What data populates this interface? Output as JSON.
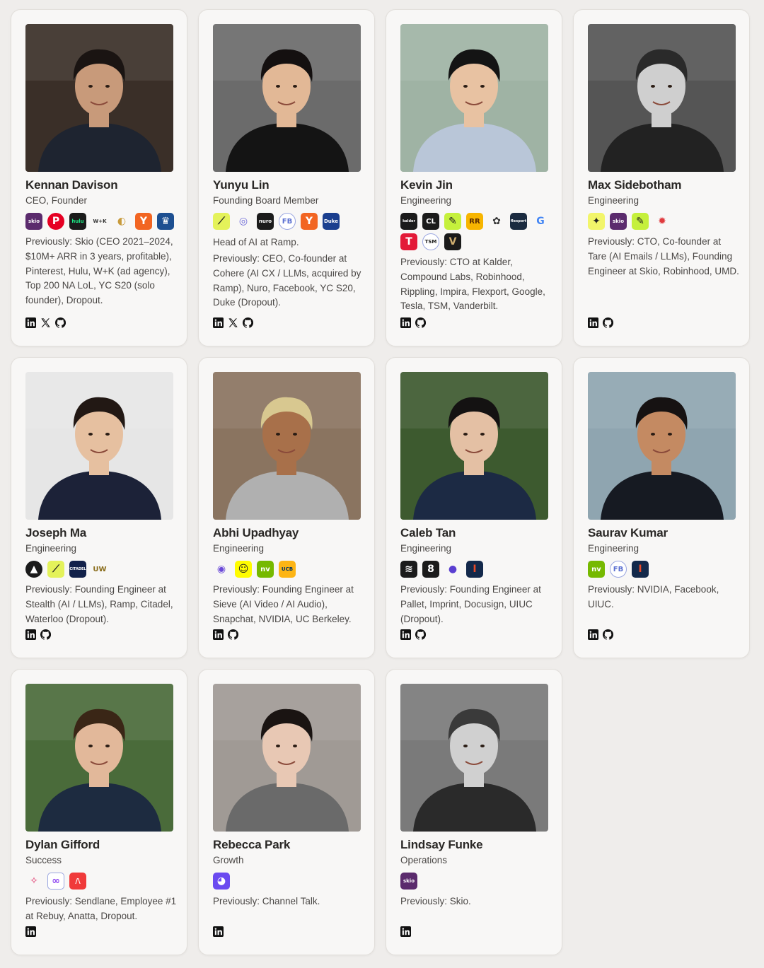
{
  "members": [
    {
      "name": "Kennan Davison",
      "role": "CEO, Founder",
      "logos": [
        {
          "icon": "skio-logo",
          "text": "skio",
          "bg": "#5b2b6d",
          "fg": "#ffffff"
        },
        {
          "icon": "pinterest-logo",
          "text": "P",
          "bg": "#e60023",
          "fg": "#ffffff",
          "shape": "round"
        },
        {
          "icon": "hulu-logo",
          "text": "hulu",
          "bg": "#1b1b1b",
          "fg": "#1ce783"
        },
        {
          "icon": "wk-logo",
          "text": "W+K",
          "bg": "transparent",
          "fg": "#333333"
        },
        {
          "icon": "lol-logo",
          "text": "◐",
          "bg": "transparent",
          "fg": "#c89b3c"
        },
        {
          "icon": "yc-logo",
          "text": "Y",
          "bg": "#f26522",
          "fg": "#ffffff"
        },
        {
          "icon": "columbia-logo",
          "text": "♛",
          "bg": "#1d4f91",
          "fg": "#ffffff"
        }
      ],
      "bio": "Previously: Skio (CEO 2021–2024, $10M+ ARR in 3 years, profitable), Pinterest, Hulu, W+K (ad agency), Top 200 NA LoL, YC S20 (solo founder), Dropout.",
      "socials": [
        "linkedin-icon",
        "x-icon",
        "github-icon"
      ]
    },
    {
      "name": "Yunyu Lin",
      "role": "Founding Board Member",
      "logos": [
        {
          "icon": "ramp-logo",
          "text": "⟋",
          "bg": "#e4f25a",
          "fg": "#222222"
        },
        {
          "icon": "cohere-logo",
          "text": "◎",
          "bg": "transparent",
          "fg": "#6e6bd8"
        },
        {
          "icon": "nuro-logo",
          "text": "nuro",
          "bg": "#1b1b1b",
          "fg": "#ffffff"
        },
        {
          "icon": "facebook-logo",
          "text": "FB",
          "bg": "#ffffff",
          "fg": "#5a6fd1",
          "shape": "round"
        },
        {
          "icon": "yc-logo",
          "text": "Y",
          "bg": "#f26522",
          "fg": "#ffffff"
        },
        {
          "icon": "duke-logo",
          "text": "Duke",
          "bg": "#1b3f8f",
          "fg": "#ffffff"
        }
      ],
      "headline": "Head of AI at Ramp.",
      "bio": "Previously: CEO, Co-founder at Cohere (AI CX / LLMs, acquired by Ramp), Nuro, Facebook, YC S20, Duke (Dropout).",
      "socials": [
        "linkedin-icon",
        "x-icon",
        "github-icon"
      ]
    },
    {
      "name": "Kevin Jin",
      "role": "Engineering",
      "logos": [
        {
          "icon": "kalder-logo",
          "text": "kalder",
          "bg": "#1b1b1b",
          "fg": "#ffffff"
        },
        {
          "icon": "compound-logo",
          "text": "CL",
          "bg": "#1b1b1b",
          "fg": "#ffffff"
        },
        {
          "icon": "robinhood-logo",
          "text": "✎",
          "bg": "#c5f03c",
          "fg": "#222222"
        },
        {
          "icon": "rippling-logo",
          "text": "RR",
          "bg": "#f7b500",
          "fg": "#5a2a00"
        },
        {
          "icon": "impira-logo",
          "text": "✿",
          "bg": "transparent",
          "fg": "#333333"
        },
        {
          "icon": "flexport-logo",
          "text": "flexport",
          "bg": "#1b2b40",
          "fg": "#ffffff"
        },
        {
          "icon": "google-logo",
          "text": "G",
          "bg": "transparent",
          "fg": "#4285f4"
        },
        {
          "icon": "tesla-logo",
          "text": "T",
          "bg": "#e31937",
          "fg": "#ffffff"
        },
        {
          "icon": "tsm-logo",
          "text": "TSM",
          "bg": "#ffffff",
          "fg": "#222222",
          "shape": "round"
        },
        {
          "icon": "vanderbilt-logo",
          "text": "V",
          "bg": "#1b1b1b",
          "fg": "#cfae70"
        }
      ],
      "bio": "Previously: CTO at Kalder, Compound Labs, Robinhood, Rippling, Impira, Flexport, Google, Tesla, TSM, Vanderbilt.",
      "socials": [
        "linkedin-icon",
        "github-icon"
      ]
    },
    {
      "name": "Max Sidebotham",
      "role": "Engineering",
      "logos": [
        {
          "icon": "tare-logo",
          "text": "✦",
          "bg": "#f2f56a",
          "fg": "#222222"
        },
        {
          "icon": "skio-logo",
          "text": "skio",
          "bg": "#5b2b6d",
          "fg": "#ffffff"
        },
        {
          "icon": "robinhood-logo",
          "text": "✎",
          "bg": "#c5f03c",
          "fg": "#222222"
        },
        {
          "icon": "umd-logo",
          "text": "✹",
          "bg": "transparent",
          "fg": "#e03a3e"
        }
      ],
      "bio": "Previously: CTO, Co-founder at Tare (AI Emails / LLMs), Founding Engineer at Skio, Robinhood, UMD.",
      "socials": [
        "linkedin-icon",
        "github-icon"
      ]
    },
    {
      "name": "Joseph Ma",
      "role": "Engineering",
      "logos": [
        {
          "icon": "stealth-logo",
          "text": "▲",
          "bg": "#1b1b1b",
          "fg": "#ffffff",
          "shape": "round"
        },
        {
          "icon": "ramp-logo",
          "text": "⟋",
          "bg": "#e4f25a",
          "fg": "#222222"
        },
        {
          "icon": "citadel-logo",
          "text": "CITADEL",
          "bg": "#12214a",
          "fg": "#ffffff"
        },
        {
          "icon": "waterloo-logo",
          "text": "UW",
          "bg": "transparent",
          "fg": "#8a6d1c"
        }
      ],
      "bio": "Previously: Founding Engineer at Stealth (AI / LLMs), Ramp, Citadel, Waterloo (Dropout).",
      "socials": [
        "linkedin-icon",
        "github-icon"
      ]
    },
    {
      "name": "Abhi Upadhyay",
      "role": "Engineering",
      "logos": [
        {
          "icon": "sieve-logo",
          "text": "◉",
          "bg": "transparent",
          "fg": "#6b4ad8"
        },
        {
          "icon": "snapchat-logo",
          "text": "☺",
          "bg": "#fffc00",
          "fg": "#222222"
        },
        {
          "icon": "nvidia-logo",
          "text": "nv",
          "bg": "#76b900",
          "fg": "#ffffff"
        },
        {
          "icon": "berkeley-logo",
          "text": "UCB",
          "bg": "#fdb515",
          "fg": "#003262"
        }
      ],
      "bio": "Previously: Founding Engineer at Sieve (AI Video / AI Audio), Snapchat, NVIDIA, UC Berkeley.",
      "socials": [
        "linkedin-icon",
        "github-icon"
      ]
    },
    {
      "name": "Caleb Tan",
      "role": "Engineering",
      "logos": [
        {
          "icon": "pallet-logo",
          "text": "≋",
          "bg": "#1b1b1b",
          "fg": "#ffffff"
        },
        {
          "icon": "imprint-logo",
          "text": "8",
          "bg": "#1b1b1b",
          "fg": "#ffffff"
        },
        {
          "icon": "docusign-logo",
          "text": "●",
          "bg": "transparent",
          "fg": "#5a3fd1"
        },
        {
          "icon": "uiuc-logo",
          "text": "I",
          "bg": "#13294b",
          "fg": "#e84a27"
        }
      ],
      "bio": "Previously: Founding Engineer at Pallet, Imprint, Docusign, UIUC (Dropout).",
      "socials": [
        "linkedin-icon",
        "github-icon"
      ]
    },
    {
      "name": "Saurav Kumar",
      "role": "Engineering",
      "logos": [
        {
          "icon": "nvidia-logo",
          "text": "nv",
          "bg": "#76b900",
          "fg": "#ffffff"
        },
        {
          "icon": "facebook-logo",
          "text": "FB",
          "bg": "#ffffff",
          "fg": "#5a6fd1",
          "shape": "round"
        },
        {
          "icon": "uiuc-logo",
          "text": "I",
          "bg": "#13294b",
          "fg": "#e84a27"
        }
      ],
      "bio": "Previously: NVIDIA, Facebook, UIUC.",
      "socials": [
        "linkedin-icon",
        "github-icon"
      ]
    },
    {
      "name": "Dylan Gifford",
      "role": "Success",
      "logos": [
        {
          "icon": "sendlane-logo",
          "text": "✧",
          "bg": "transparent",
          "fg": "#e03a6f"
        },
        {
          "icon": "rebuy-logo",
          "text": "∞",
          "bg": "#ffffff",
          "fg": "#8a3ff0"
        },
        {
          "icon": "anatta-logo",
          "text": "/\\",
          "bg": "#f03a3a",
          "fg": "#ffffff"
        }
      ],
      "bio": "Previously: Sendlane, Employee #1 at Rebuy, Anatta, Dropout.",
      "socials": [
        "linkedin-icon"
      ]
    },
    {
      "name": "Rebecca Park",
      "role": "Growth",
      "logos": [
        {
          "icon": "channel-talk-logo",
          "text": "◕",
          "bg": "#6b4af0",
          "fg": "#ffffff"
        }
      ],
      "bio": "Previously: Channel Talk.",
      "socials": [
        "linkedin-icon"
      ]
    },
    {
      "name": "Lindsay Funke",
      "role": "Operations",
      "logos": [
        {
          "icon": "skio-logo",
          "text": "skio",
          "bg": "#5b2b6d",
          "fg": "#ffffff"
        }
      ],
      "bio": "Previously: Skio.",
      "socials": [
        "linkedin-icon"
      ]
    }
  ]
}
